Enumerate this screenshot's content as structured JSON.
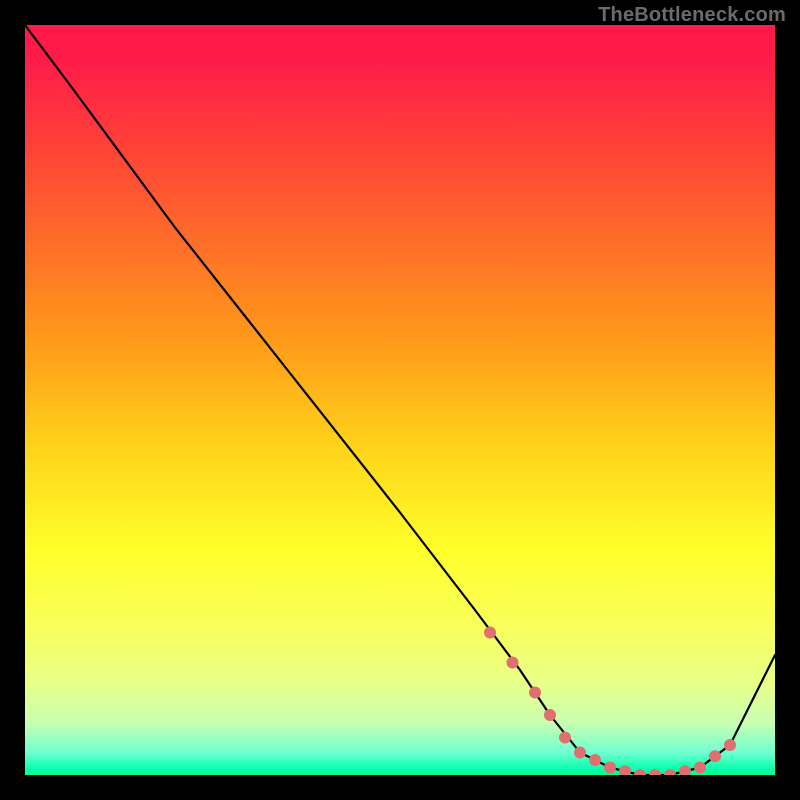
{
  "attribution": "TheBottleneck.com",
  "colors": {
    "page_bg": "#000000",
    "attribution_text": "#6b6b6b",
    "curve_stroke": "#000000",
    "marker_fill": "#e07070",
    "gradient_stops": [
      "#ff1a4a",
      "#ff3a3a",
      "#ff6a2a",
      "#ff9a1a",
      "#ffd21a",
      "#ffff2a",
      "#f8ff5a",
      "#e8ff8a",
      "#c8ffb0",
      "#70ffd0",
      "#10ffb0",
      "#00ff90"
    ]
  },
  "chart_data": {
    "type": "line",
    "title": "",
    "xlabel": "",
    "ylabel": "",
    "xlim": [
      0,
      100
    ],
    "ylim": [
      0,
      100
    ],
    "grid": false,
    "legend": null,
    "series": [
      {
        "name": "bottleneck-curve",
        "x": [
          0,
          6,
          20,
          35,
          50,
          60,
          66,
          70,
          74,
          78,
          82,
          86,
          90,
          94,
          100
        ],
        "y": [
          100,
          92,
          73,
          54,
          35,
          22,
          14,
          8,
          3,
          1,
          0,
          0,
          1,
          4,
          16
        ]
      }
    ],
    "markers": {
      "name": "highlighted-points",
      "x": [
        62,
        65,
        68,
        70,
        72,
        74,
        76,
        78,
        80,
        82,
        84,
        86,
        88,
        90,
        92,
        94
      ],
      "y": [
        19,
        15,
        11,
        8,
        5,
        3,
        2,
        1,
        0.5,
        0,
        0,
        0,
        0.5,
        1,
        2.5,
        4
      ]
    }
  }
}
